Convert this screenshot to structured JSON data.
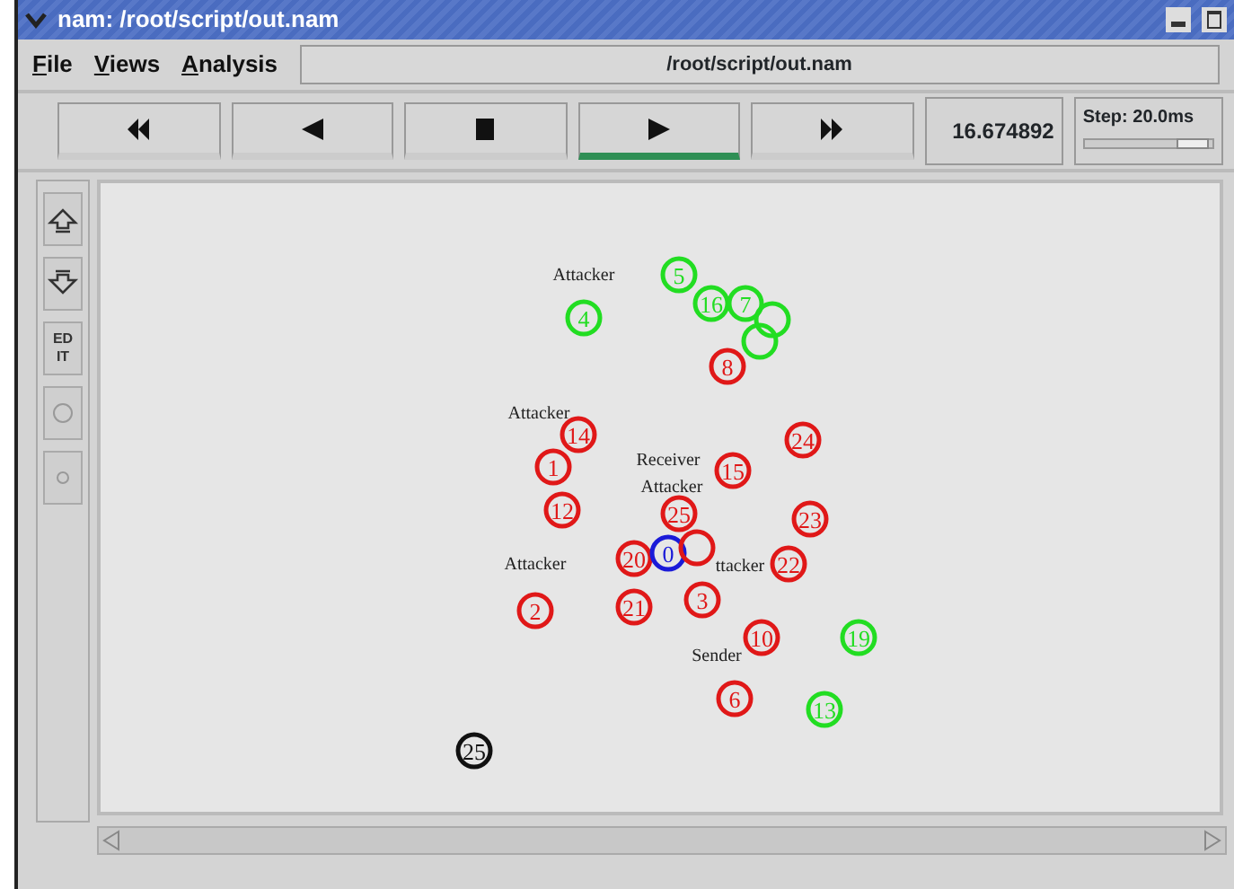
{
  "window": {
    "title": "nam: /root/script/out.nam"
  },
  "menu": [
    {
      "label": "File"
    },
    {
      "label": "Views"
    },
    {
      "label": "Analysis"
    }
  ],
  "file_path": "/root/script/out.nam",
  "playback_buttons": [
    {
      "kind": "rewind",
      "selected": false
    },
    {
      "kind": "back",
      "selected": false
    },
    {
      "kind": "stop",
      "selected": false
    },
    {
      "kind": "play",
      "selected": true
    },
    {
      "kind": "forward",
      "selected": false
    }
  ],
  "time": "16.674892",
  "step": {
    "label": "Step: 20.0ms",
    "level": 0.85
  },
  "side_tools": [
    {
      "kind": "zoom-in"
    },
    {
      "kind": "zoom-out"
    },
    {
      "kind": "text",
      "label": "ED IT"
    },
    {
      "kind": "big-circle"
    },
    {
      "kind": "small-circle"
    }
  ],
  "node_labels": [
    {
      "text": "Attacker"
    },
    {
      "text": "Attacker"
    },
    {
      "text": "Receiver"
    },
    {
      "text": "Attacker"
    },
    {
      "text": "ttacker"
    },
    {
      "text": "Attacker"
    },
    {
      "text": "Sender"
    }
  ],
  "nodes": [
    {
      "label": "4",
      "color": "#22dd22"
    },
    {
      "label": "5",
      "color": "#22dd22"
    },
    {
      "label": "16",
      "color": "#22dd22"
    },
    {
      "label": "7",
      "color": "#22dd22"
    },
    {
      "color": "#22dd22"
    },
    {
      "color": "#22dd22"
    },
    {
      "label": "8",
      "color": "#e01818"
    },
    {
      "label": "24",
      "color": "#e01818"
    },
    {
      "label": "14",
      "color": "#e01818"
    },
    {
      "label": "1",
      "color": "#e01818"
    },
    {
      "label": "15",
      "color": "#e01818"
    },
    {
      "label": "12",
      "color": "#e01818"
    },
    {
      "label": "25",
      "color": "#e01818"
    },
    {
      "label": "23",
      "color": "#e01818"
    },
    {
      "label": "20",
      "color": "#e01818"
    },
    {
      "label": "0",
      "color": "#1a1ad8"
    },
    {
      "color": "#e01818"
    },
    {
      "label": "22",
      "color": "#e01818"
    },
    {
      "label": "2",
      "color": "#e01818"
    },
    {
      "label": "21",
      "color": "#e01818"
    },
    {
      "label": "3",
      "color": "#e01818"
    },
    {
      "label": "10",
      "color": "#e01818"
    },
    {
      "label": "19",
      "color": "#22dd22"
    },
    {
      "label": "6",
      "color": "#e01818"
    },
    {
      "label": "13",
      "color": "#22dd22"
    },
    {
      "label": "25",
      "color": "#111111"
    }
  ]
}
